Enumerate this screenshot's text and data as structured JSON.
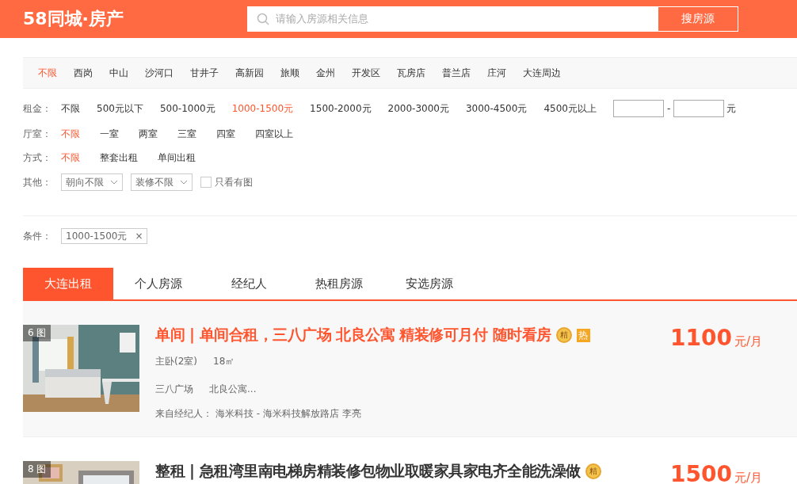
{
  "header": {
    "logo": "58同城·房产",
    "search_placeholder": "请输入房源相关信息",
    "search_button": "搜房源"
  },
  "districts": [
    {
      "label": "不限",
      "selected": true
    },
    {
      "label": "西岗",
      "selected": false
    },
    {
      "label": "中山",
      "selected": false
    },
    {
      "label": "沙河口",
      "selected": false
    },
    {
      "label": "甘井子",
      "selected": false
    },
    {
      "label": "高新园",
      "selected": false
    },
    {
      "label": "旅顺",
      "selected": false
    },
    {
      "label": "金州",
      "selected": false
    },
    {
      "label": "开发区",
      "selected": false
    },
    {
      "label": "瓦房店",
      "selected": false
    },
    {
      "label": "普兰店",
      "selected": false
    },
    {
      "label": "庄河",
      "selected": false
    },
    {
      "label": "大连周边",
      "selected": false
    }
  ],
  "filters": [
    {
      "kind": "options",
      "label": "租金：",
      "options": [
        {
          "label": "不限",
          "selected": false
        },
        {
          "label": "500元以下",
          "selected": false
        },
        {
          "label": "500-1000元",
          "selected": false
        },
        {
          "label": "1000-1500元",
          "selected": true
        },
        {
          "label": "1500-2000元",
          "selected": false
        },
        {
          "label": "2000-3000元",
          "selected": false
        },
        {
          "label": "3000-4500元",
          "selected": false
        },
        {
          "label": "4500元以上",
          "selected": false
        }
      ],
      "range": {
        "separator": "-",
        "unit": "元"
      }
    },
    {
      "kind": "options",
      "label": "厅室：",
      "options": [
        {
          "label": "不限",
          "selected": true
        },
        {
          "label": "一室",
          "selected": false
        },
        {
          "label": "两室",
          "selected": false
        },
        {
          "label": "三室",
          "selected": false
        },
        {
          "label": "四室",
          "selected": false
        },
        {
          "label": "四室以上",
          "selected": false
        }
      ]
    },
    {
      "kind": "options",
      "label": "方式：",
      "options": [
        {
          "label": "不限",
          "selected": true
        },
        {
          "label": "整套出租",
          "selected": false
        },
        {
          "label": "单间出租",
          "selected": false
        }
      ]
    },
    {
      "kind": "controls",
      "label": "其他：",
      "dropdowns": [
        "朝向不限",
        "装修不限"
      ],
      "checkbox": {
        "label": "只看有图",
        "checked": false
      }
    }
  ],
  "conditions": {
    "label": "条件：",
    "tags": [
      {
        "text": "1000-1500元",
        "remove": "×"
      }
    ]
  },
  "tabs": [
    {
      "label": "大连出租",
      "selected": true
    },
    {
      "label": "个人房源",
      "selected": false
    },
    {
      "label": "经纪人",
      "selected": false
    },
    {
      "label": "热租房源",
      "selected": false
    },
    {
      "label": "安选房源",
      "selected": false
    }
  ],
  "listings": [
    {
      "highlighted": true,
      "photo_count": "6 图",
      "title": "单间 | 单间合租，三八广场 北良公寓 精装修可月付 随时看房",
      "badges": [
        {
          "kind": "medal",
          "text": "精"
        },
        {
          "kind": "hot",
          "text": "热"
        }
      ],
      "details": [
        "主卧(2室)",
        "18㎡"
      ],
      "location": [
        "三八广场",
        "北良公寓..."
      ],
      "agent": "来自经纪人： 海米科技 - 海米科技解放路店 李亮",
      "price": "1100",
      "unit": "元/月"
    },
    {
      "highlighted": false,
      "photo_count": "8 图",
      "title": "整租 | 急租湾里南电梯房精装修包物业取暖家具家电齐全能洗澡做",
      "badges": [
        {
          "kind": "medal",
          "text": "精"
        }
      ],
      "price": "1500",
      "unit": "元/月"
    }
  ]
}
